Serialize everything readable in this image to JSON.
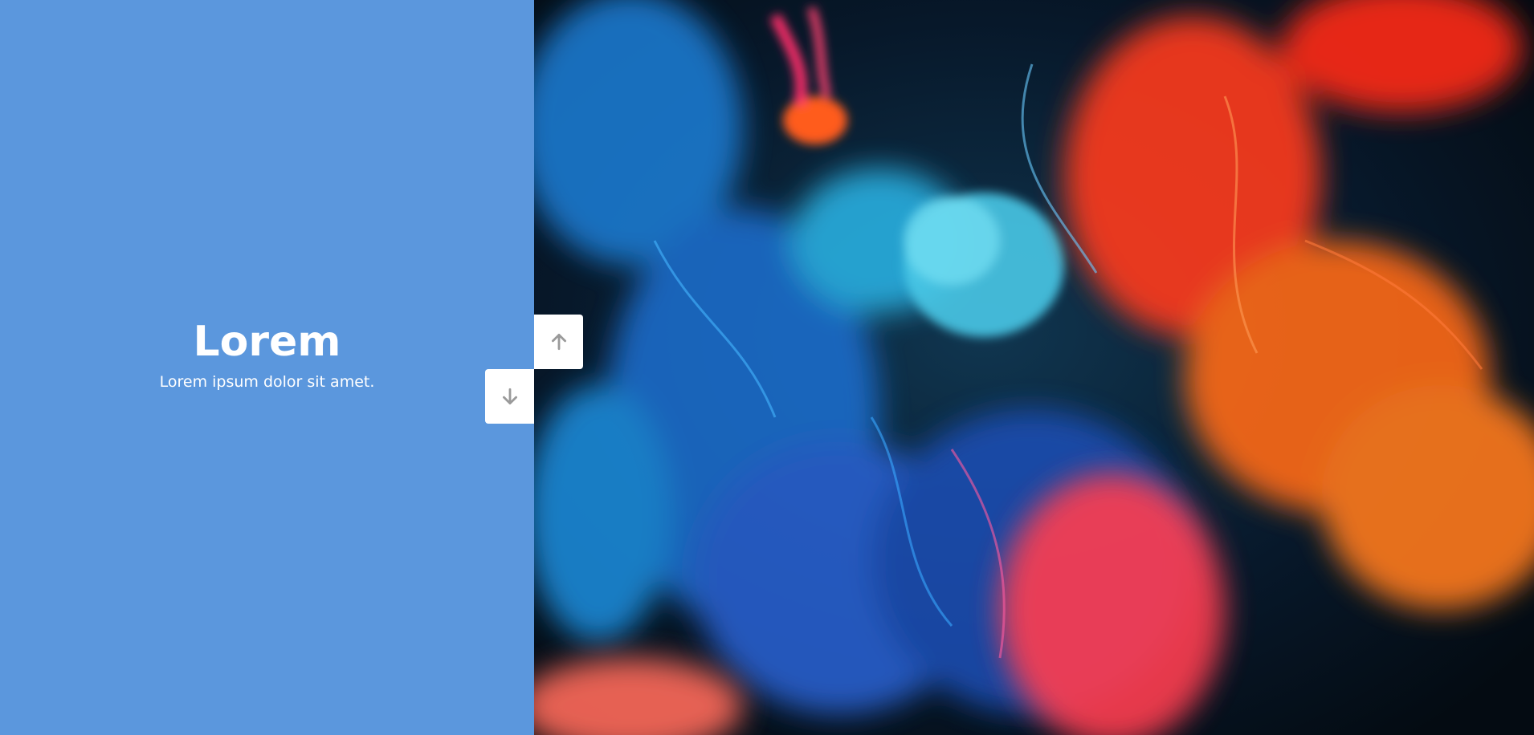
{
  "slide": {
    "title": "Lorem",
    "subtitle": "Lorem ipsum dolor sit amet."
  },
  "controls": {
    "up_icon": "arrow-up-icon",
    "down_icon": "arrow-down-icon"
  },
  "colors": {
    "left_panel": "#5b97dd",
    "text": "#ffffff",
    "button_bg": "#ffffff",
    "button_icon": "#9a9a9a",
    "image_background": "#07141f",
    "ink_blue": "#1ea7ff",
    "ink_orange": "#ff5a1f",
    "ink_red": "#ff2d4b"
  }
}
